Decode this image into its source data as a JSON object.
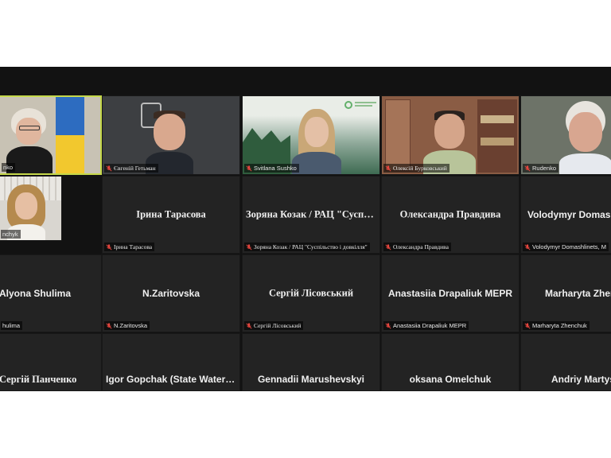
{
  "participants": [
    {
      "display": "",
      "tag": "nko"
    },
    {
      "display": "",
      "tag": "Євгеній Гетьман"
    },
    {
      "display": "",
      "tag": "Svitlana Sushko"
    },
    {
      "display": "",
      "tag": "Олексій Бурковський"
    },
    {
      "display": "",
      "tag": "Rudenko"
    },
    {
      "display": "",
      "tag": "nchyk"
    },
    {
      "display": "Ірина Тарасова",
      "tag": "Ірина Тарасова"
    },
    {
      "display": "Зоряна Козак / РАЦ \"Суспіль…",
      "tag": "Зоряна Козак / РАЦ \"Суспільство і довкілля\""
    },
    {
      "display": "Олександра Правдива",
      "tag": "Олександра Правдива"
    },
    {
      "display": "Volodymyr Domash",
      "tag": "Volodymyr Domashlinets, M"
    },
    {
      "display": "Alyona Shulima",
      "tag": "hulima"
    },
    {
      "display": "N.Zaritovska",
      "tag": "N.Zaritovska"
    },
    {
      "display": "Сергій Лісовський",
      "tag": "Сергій Лісовський"
    },
    {
      "display": "Anastasiia Drapaliuk MEPR",
      "tag": "Anastasiia Drapaliuk MEPR"
    },
    {
      "display": "Marharyta Zhen",
      "tag": "Marharyta Zhenchuk"
    },
    {
      "display": "Сергій Панченко",
      "tag": ""
    },
    {
      "display": "Igor Gopchak (State Water …",
      "tag": ""
    },
    {
      "display": "Gennadii Marushevskyi",
      "tag": ""
    },
    {
      "display": "oksana Omelchuk",
      "tag": ""
    },
    {
      "display": "Andriy Martys",
      "tag": ""
    }
  ],
  "colors": {
    "active_speaker_border": "#c5d84a",
    "mic_off": "#e8473f",
    "meeting_bg": "#121212",
    "tile_bg": "#232323"
  },
  "icons": {
    "mic_off": "mic-off-icon",
    "logo": "organization-logo"
  }
}
